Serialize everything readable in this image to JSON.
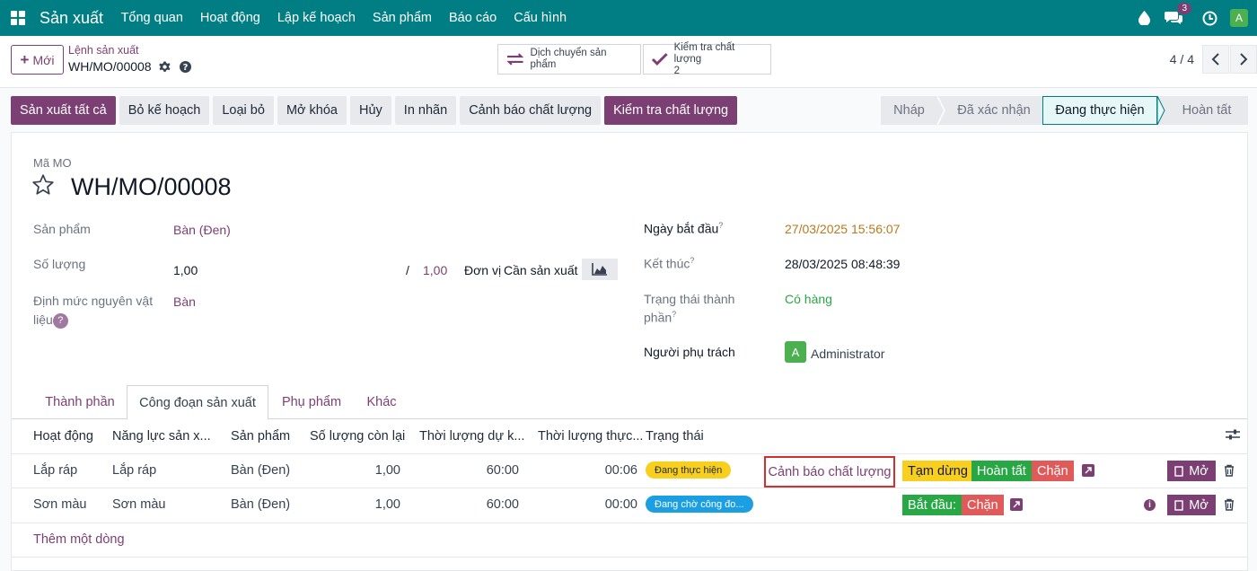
{
  "navbar": {
    "brand": "Sản xuất",
    "menu": [
      "Tổng quan",
      "Hoạt động",
      "Lập kế hoạch",
      "Sản phẩm",
      "Báo cáo",
      "Cấu hình"
    ],
    "message_count": "3",
    "user_initial": "A"
  },
  "control": {
    "new_label": "Mới",
    "breadcrumb_parent": "Lệnh sản xuất",
    "breadcrumb_current": "WH/MO/00008",
    "smart_move_label": "Dịch chuyển sản phẩm",
    "smart_quality_label": "Kiểm tra chất lượng",
    "smart_quality_count": "2",
    "pager": "4 / 4"
  },
  "actions": [
    "Sản xuất tất cả",
    "Bỏ kế hoạch",
    "Loại bỏ",
    "Mở khóa",
    "Hủy",
    "In nhãn",
    "Cảnh báo chất lượng",
    "Kiểm tra chất lượng"
  ],
  "stages": [
    "Nháp",
    "Đã xác nhận",
    "Đang thực hiện",
    "Hoàn tất"
  ],
  "form": {
    "mo_label": "Mã MO",
    "mo_name": "WH/MO/00008",
    "product_label": "Sản phẩm",
    "product_value": "Bàn (Đen)",
    "qty_label": "Số lượng",
    "qty_value": "1,00",
    "qty_sep": "/",
    "qty_total": "1,00",
    "uom_label": "Đơn vị",
    "uom_value": "Cần sản xuất",
    "bom_label_1": "Định mức nguyên vật",
    "bom_label_2": "liệu",
    "bom_help": "?",
    "bom_value": "Bàn",
    "start_label": "Ngày bắt đầu",
    "start_value": "27/03/2025 15:56:07",
    "end_label": "Kết thúc",
    "end_value": "28/03/2025 08:48:39",
    "state_label_1": "Trạng thái thành",
    "state_label_2": "phần",
    "state_value": "Có hàng",
    "resp_label": "Người phụ trách",
    "resp_initial": "A",
    "resp_value": "Administrator",
    "sup_mark": "?"
  },
  "tabs": [
    "Thành phần",
    "Công đoạn sản xuất",
    "Phụ phẩm",
    "Khác"
  ],
  "table": {
    "headers": [
      "Hoạt động",
      "Năng lực sản x...",
      "Sản phẩm",
      "Số lượng còn lại",
      "Thời lượng dự k...",
      "Thời lượng thực...",
      "Trạng thái"
    ],
    "rows": [
      {
        "operation": "Lắp ráp",
        "workcenter": "Lắp ráp",
        "product": "Bàn (Đen)",
        "qty_remaining": "1,00",
        "expected": "60:00",
        "real": "00:06",
        "status": "Đang thực hiện",
        "quality_alert": "Cảnh báo chất lượng",
        "btn_pause": "Tạm dừng",
        "btn_done": "Hoàn tất",
        "btn_block": "Chặn",
        "btn_open": "Mở"
      },
      {
        "operation": "Sơn màu",
        "workcenter": "Sơn màu",
        "product": "Bàn (Đen)",
        "qty_remaining": "1,00",
        "expected": "60:00",
        "real": "00:00",
        "status": "Đang chờ công đo...",
        "btn_start": "Bắt đầu:",
        "btn_block": "Chặn",
        "btn_open": "Mở"
      }
    ],
    "add_line": "Thêm một dòng"
  }
}
